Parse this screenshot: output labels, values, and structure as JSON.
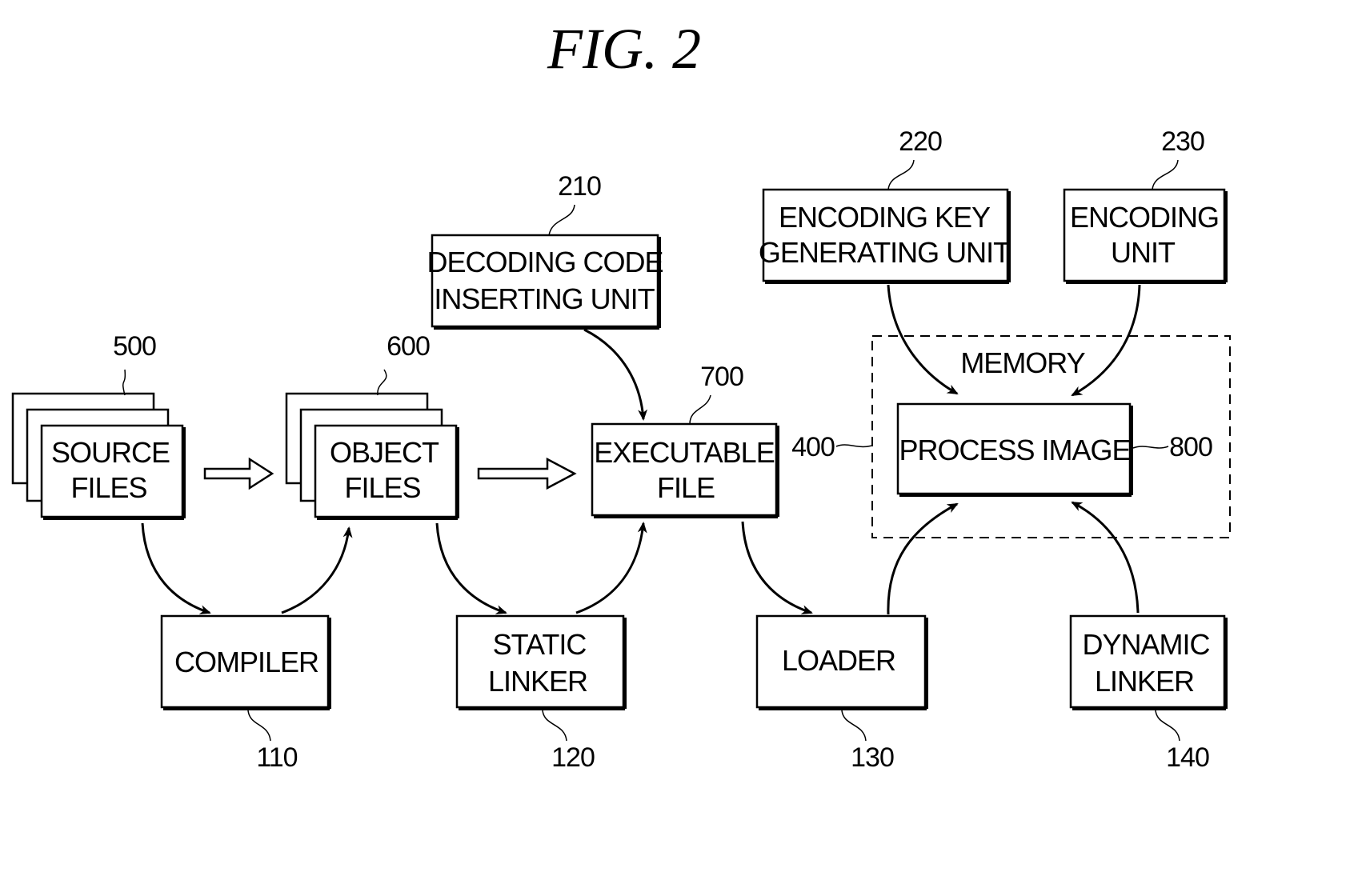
{
  "figure": {
    "title": "FIG. 2"
  },
  "boxes": {
    "source_files": {
      "lines": [
        "SOURCE",
        "FILES"
      ],
      "ref": "500"
    },
    "object_files": {
      "lines": [
        "OBJECT",
        "FILES"
      ],
      "ref": "600"
    },
    "executable_file": {
      "lines": [
        "EXECUTABLE",
        "FILE"
      ],
      "ref": "700"
    },
    "process_image": {
      "lines": [
        "PROCESS IMAGE"
      ],
      "ref": "800"
    },
    "decoding_code_inserting_unit": {
      "lines": [
        "DECODING CODE",
        "INSERTING UNIT"
      ],
      "ref": "210"
    },
    "encoding_key_generating_unit": {
      "lines": [
        "ENCODING KEY",
        "GENERATING UNIT"
      ],
      "ref": "220"
    },
    "encoding_unit": {
      "lines": [
        "ENCODING",
        "UNIT"
      ],
      "ref": "230"
    },
    "compiler": {
      "lines": [
        "COMPILER"
      ],
      "ref": "110"
    },
    "static_linker": {
      "lines": [
        "STATIC",
        "LINKER"
      ],
      "ref": "120"
    },
    "loader": {
      "lines": [
        "LOADER"
      ],
      "ref": "130"
    },
    "dynamic_linker": {
      "lines": [
        "DYNAMIC",
        "LINKER"
      ],
      "ref": "140"
    }
  },
  "memory": {
    "label": "MEMORY",
    "ref": "400"
  },
  "edges": [
    {
      "from": "source_files",
      "to": "object_files",
      "style": "hollow-arrow"
    },
    {
      "from": "object_files",
      "to": "executable_file",
      "style": "hollow-arrow"
    },
    {
      "from": "source_files",
      "to": "compiler",
      "style": "curved-arrow"
    },
    {
      "from": "compiler",
      "to": "object_files",
      "style": "curved-arrow"
    },
    {
      "from": "object_files",
      "to": "static_linker",
      "style": "curved-arrow"
    },
    {
      "from": "static_linker",
      "to": "executable_file",
      "style": "curved-arrow"
    },
    {
      "from": "decoding_code_inserting_unit",
      "to": "executable_file",
      "style": "curved-arrow"
    },
    {
      "from": "executable_file",
      "to": "loader",
      "style": "curved-arrow"
    },
    {
      "from": "loader",
      "to": "process_image",
      "style": "curved-arrow"
    },
    {
      "from": "dynamic_linker",
      "to": "process_image",
      "style": "curved-arrow"
    },
    {
      "from": "encoding_key_generating_unit",
      "to": "process_image",
      "style": "curved-arrow"
    },
    {
      "from": "encoding_unit",
      "to": "process_image",
      "style": "curved-arrow"
    }
  ]
}
